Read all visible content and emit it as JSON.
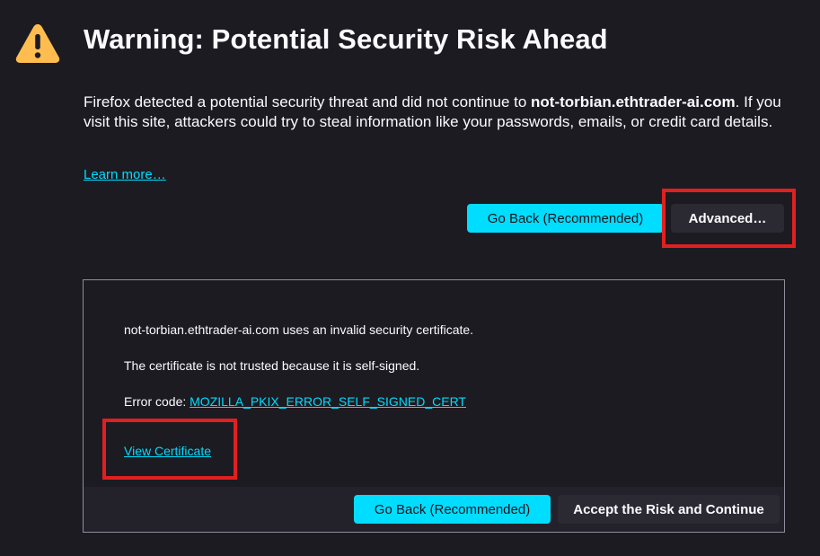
{
  "header": {
    "icon": "warning-icon",
    "title": "Warning: Potential Security Risk Ahead"
  },
  "description": {
    "before": "Firefox detected a potential security threat and did not continue to ",
    "domain": "not-torbian.ethtrader-ai.com",
    "after": ". If you visit this site, attackers could try to steal information like your passwords, emails, or credit card details."
  },
  "learn_more": "Learn more…",
  "actions": {
    "go_back": "Go Back (Recommended)",
    "advanced": "Advanced…"
  },
  "advanced_panel": {
    "invalid_cert": "not-torbian.ethtrader-ai.com uses an invalid security certificate.",
    "reason": "The certificate is not trusted because it is self-signed.",
    "error_code_label": "Error code: ",
    "error_code": "MOZILLA_PKIX_ERROR_SELF_SIGNED_CERT",
    "view_certificate": "View Certificate",
    "go_back": "Go Back (Recommended)",
    "accept": "Accept the Risk and Continue"
  },
  "colors": {
    "background": "#1c1b22",
    "accent": "#00ddff",
    "warning": "#ffbd4f",
    "highlight": "#e02020"
  }
}
